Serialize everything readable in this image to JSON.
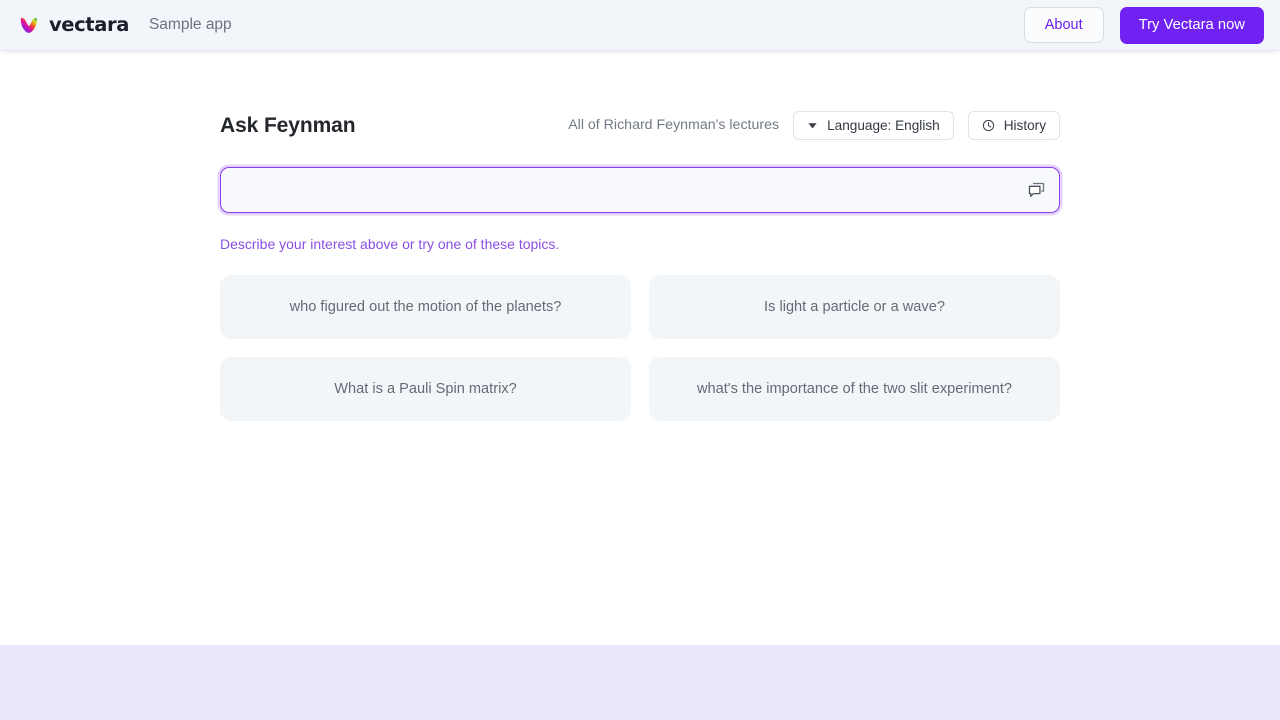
{
  "header": {
    "brand_name": "vectara",
    "brand_logo_icon": "vectara-v-logo",
    "app_subtitle": "Sample app",
    "about_label": "About",
    "try_label": "Try Vectara now"
  },
  "main": {
    "page_title": "Ask Feynman",
    "corpus_label": "All of Richard Feynman's lectures",
    "language_button": {
      "label": "Language: English",
      "icon": "chevron-down-icon"
    },
    "history_button": {
      "label": "History",
      "icon": "clock-icon"
    },
    "search": {
      "value": "",
      "placeholder": "",
      "trailing_icon": "chat-bubbles-icon"
    },
    "hint": "Describe your interest above or try one of these topics.",
    "topics": [
      "who figured out the motion of the planets?",
      "Is light a particle or a wave?",
      "What is a Pauli Spin matrix?",
      "what's the importance of the two slit experiment?"
    ]
  },
  "colors": {
    "accent_purple": "#6f22f2",
    "hint_purple": "#8a4fe0",
    "header_bg": "#f2f5f9",
    "card_bg": "#f3f6f9",
    "footer_bg": "#eae6fb",
    "input_border": "#8b3ef0"
  }
}
